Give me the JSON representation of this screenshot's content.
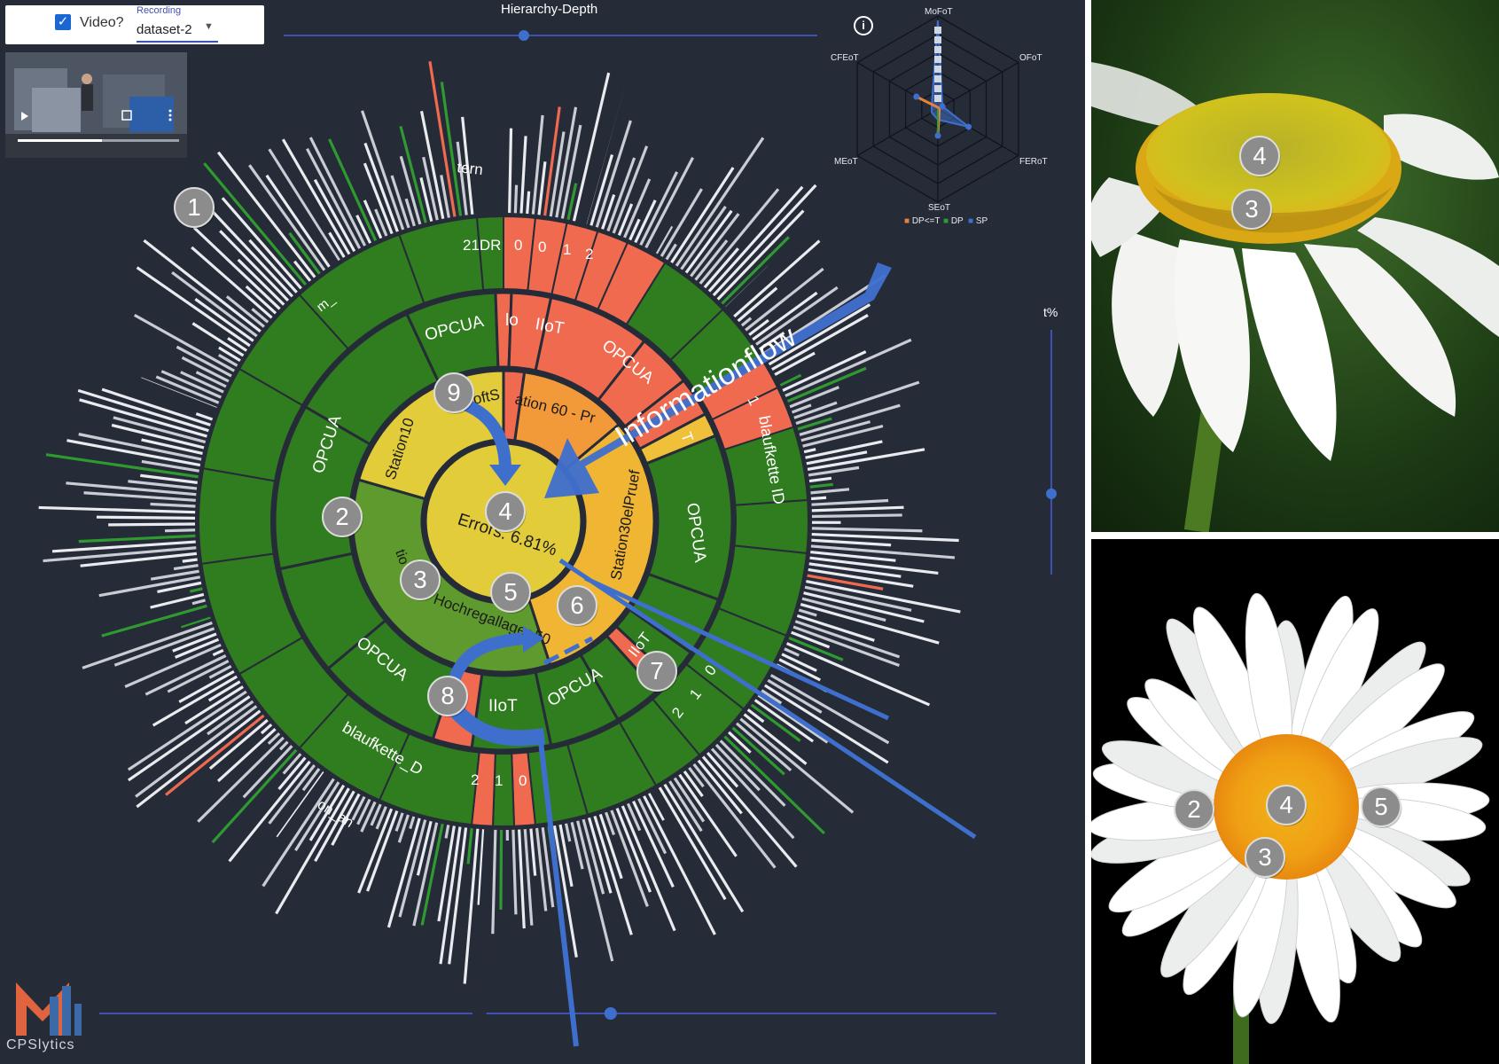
{
  "controls": {
    "video_label": "Video?",
    "recording_label": "Recording",
    "dataset_value": "dataset-2",
    "hierarchy_label": "Hierarchy-Depth",
    "threshold_label": "t%",
    "hierarchy_value": 0.45,
    "threshold_value": 0.67,
    "bottom_slider_value": 0.57
  },
  "sunburst": {
    "center_label": "Errors: 6.81%",
    "ring1": [
      "Station10",
      "oftS",
      "ation 60 - Pr",
      "Station30elPruef",
      "tio",
      "Hochregallager 50"
    ],
    "ring2": [
      "OPCUA",
      "OPCUA",
      "lo",
      "IIoT",
      "OPCUA",
      "T",
      "1",
      "blaufkette ID",
      "OPCUA",
      "IIoT",
      "0",
      "1",
      "2",
      "OPCUA",
      "IIoT",
      "OPCUA",
      "blaufkette_D",
      "2",
      "1",
      "0"
    ],
    "ring3": [
      "tern",
      "21DR",
      "0",
      "0",
      "1",
      "2",
      "m_",
      "on_an"
    ],
    "flow_label": "Informationflow"
  },
  "markers": [
    "1",
    "2",
    "3",
    "4",
    "5",
    "6",
    "7",
    "8",
    "9"
  ],
  "radar": {
    "axes": [
      "MoFoT",
      "OFoT",
      "FERoT",
      "SEoT",
      "MEoT",
      "CFEoT"
    ],
    "legend": [
      "DP<=T",
      "DP",
      "SP"
    ]
  },
  "logo_text": "CPSlytics",
  "flowers": {
    "top_markers": [
      "4",
      "3"
    ],
    "bottom_markers": [
      "2",
      "4",
      "5",
      "3"
    ]
  },
  "colors": {
    "background": "#262b38",
    "green": "#2f7d1f",
    "red": "#f06a50",
    "yellow": "#e2cc3a",
    "blue": "#3f6fcc"
  }
}
